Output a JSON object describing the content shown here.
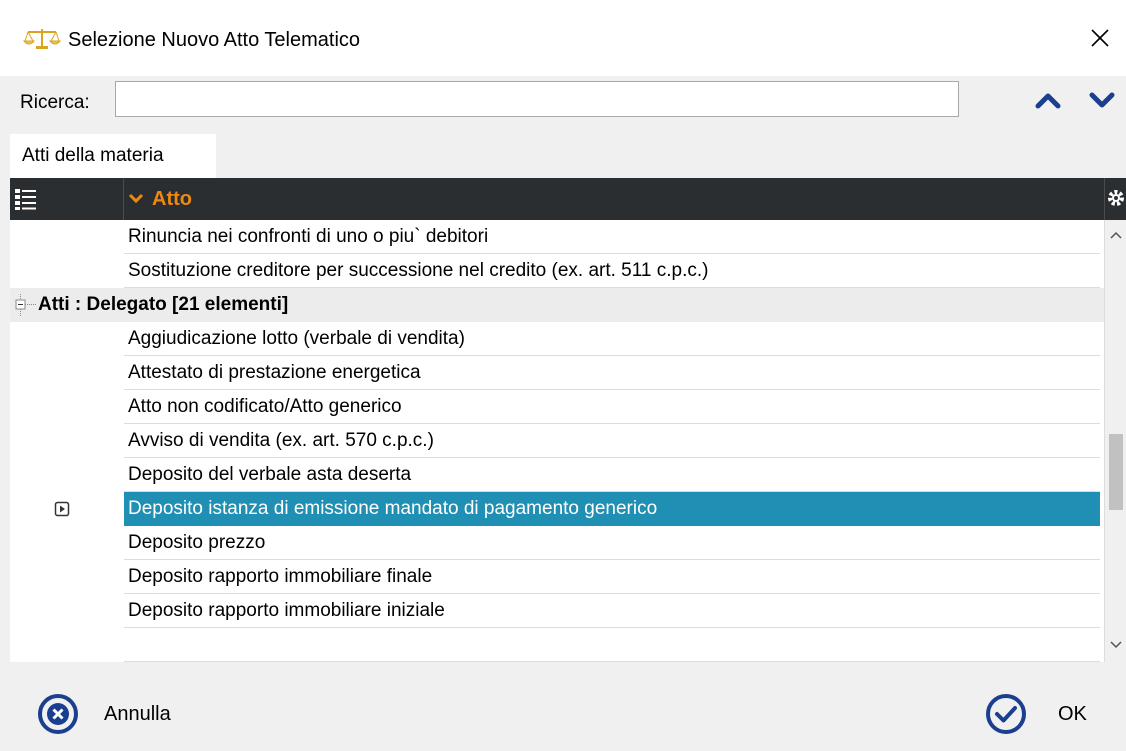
{
  "window": {
    "title": "Selezione Nuovo Atto Telematico",
    "icon": "scales-icon"
  },
  "search": {
    "label": "Ricerca:",
    "value": "",
    "placeholder": ""
  },
  "tabs": [
    {
      "label": "Atti della materia",
      "active": true
    }
  ],
  "grid": {
    "column_header": "Atto",
    "rows_before_group": [
      "Rinuncia nei confronti di uno o piu` debitori",
      "Sostituzione creditore per successione nel credito (ex. art. 511 c.p.c.)"
    ],
    "group": {
      "label": "Atti : Delegato  [21 elementi]",
      "rows": [
        "Aggiudicazione lotto (verbale di vendita)",
        "Attestato di prestazione energetica",
        "Atto non codificato/Atto generico",
        "Avviso di vendita (ex. art. 570 c.p.c.)",
        "Deposito del verbale asta deserta",
        "Deposito istanza di emissione mandato di pagamento generico",
        "Deposito prezzo",
        "Deposito rapporto immobiliare finale",
        "Deposito rapporto immobiliare iniziale"
      ],
      "selected_index": 5
    }
  },
  "buttons": {
    "cancel_label": "Annulla",
    "ok_label": "OK"
  },
  "colors": {
    "header_bg": "#2b2e31",
    "header_text": "#f0870f",
    "selection": "#1f8fb3",
    "button_icon": "#1a3f8f"
  }
}
